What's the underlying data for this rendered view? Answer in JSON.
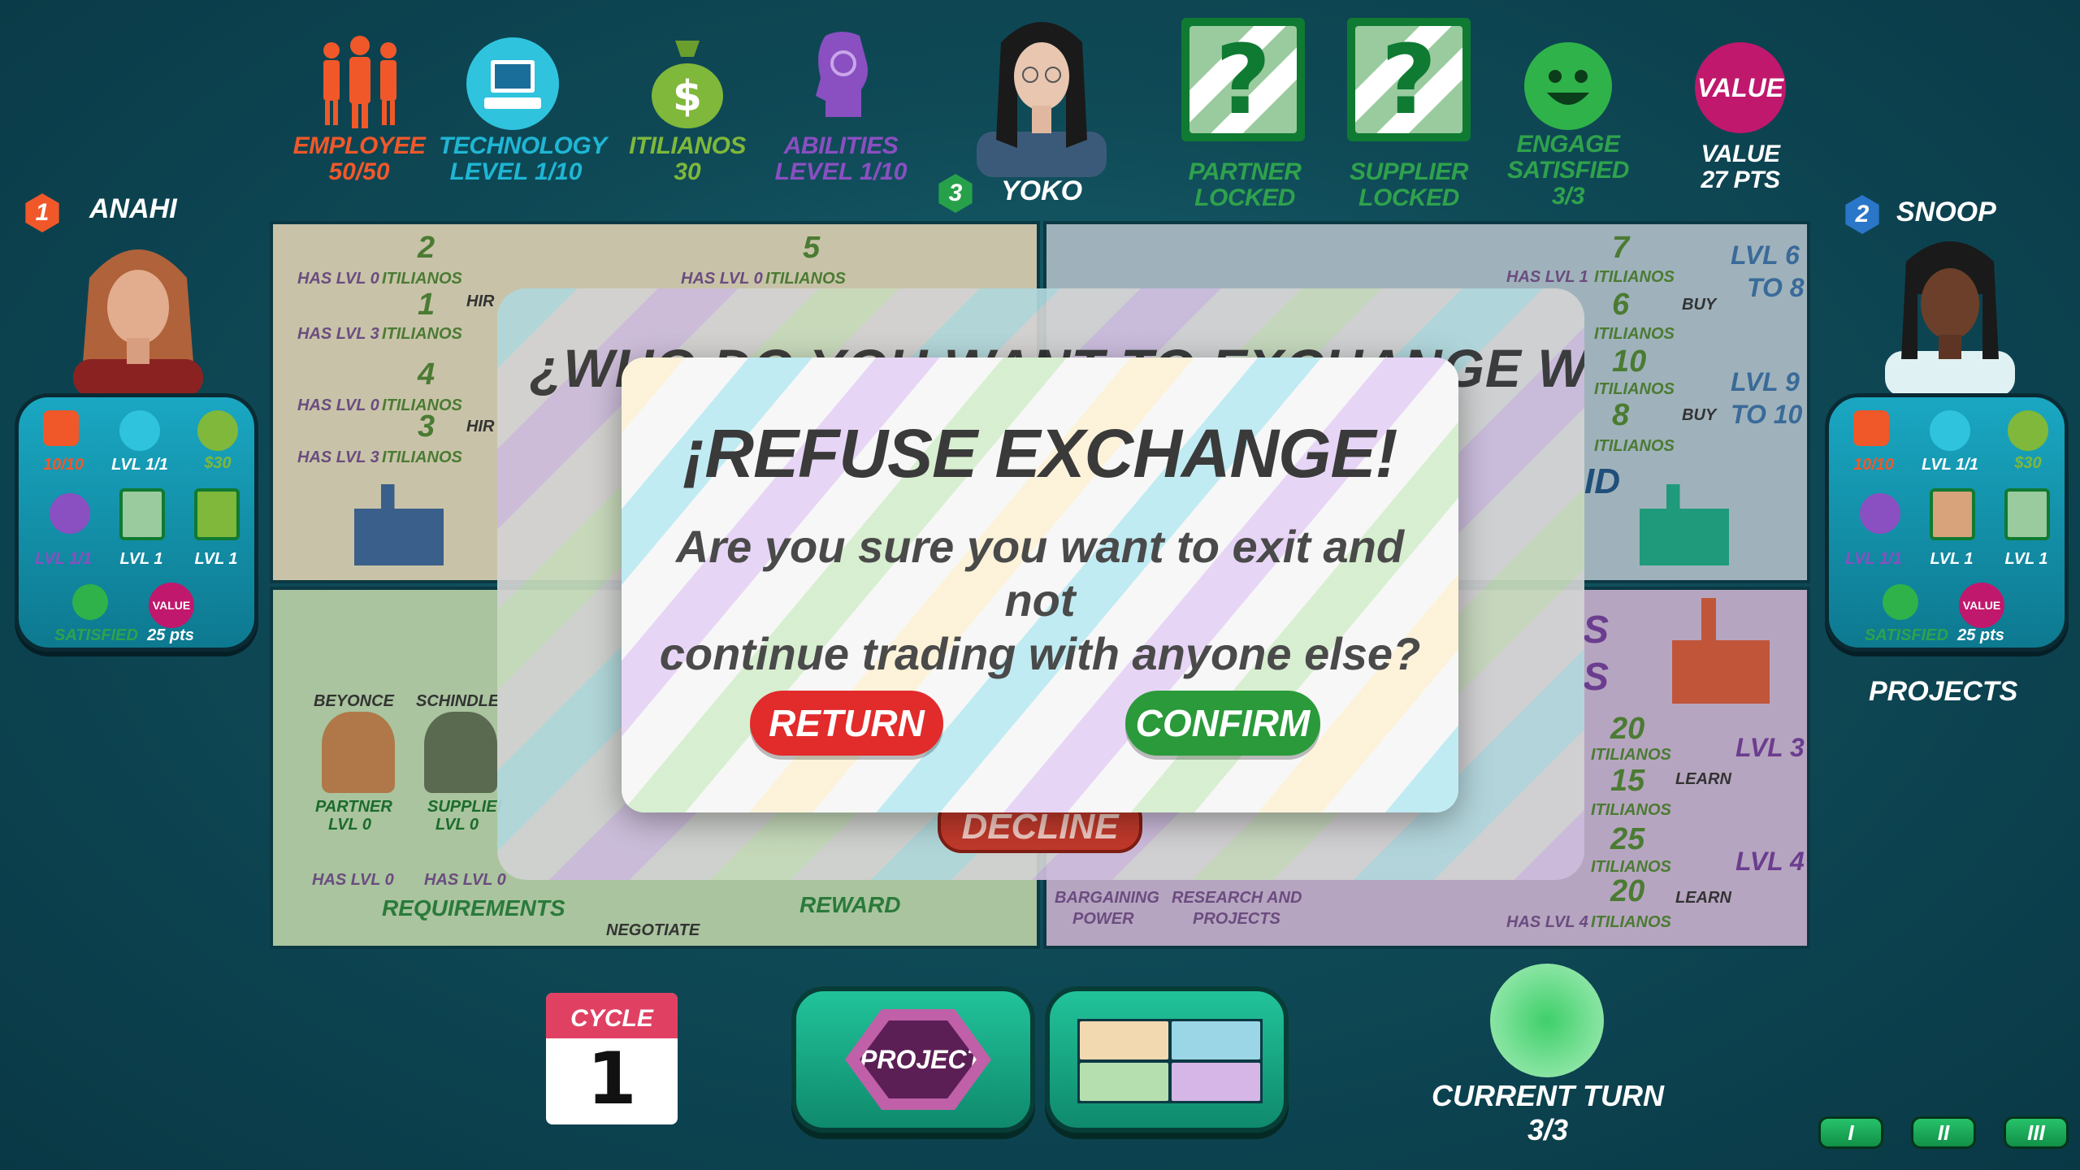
{
  "top": {
    "employee": {
      "label": "EMPLOYEE",
      "value": "50/50",
      "color": "#f0582a"
    },
    "technology": {
      "label": "TECHNOLOGY",
      "value": "LEVEL 1/10",
      "color": "#1fb6d4"
    },
    "itilianos": {
      "label": "ITILIANOS",
      "value": "30",
      "color": "#7fb83a"
    },
    "abilities": {
      "label": "ABILITIES",
      "value": "LEVEL 1/10",
      "color": "#8a4fc1"
    },
    "player": {
      "number": "3",
      "name": "YOKO"
    },
    "partner": {
      "line1": "PARTNER",
      "line2": "LOCKED"
    },
    "supplier": {
      "line1": "SUPPLIER",
      "line2": "LOCKED"
    },
    "engage": {
      "line1": "ENGAGE",
      "line2": "SATISFIED",
      "line3": "3/3"
    },
    "value": {
      "badge": "VALUE",
      "line1": "VALUE",
      "line2": "27 PTS"
    }
  },
  "left_player": {
    "number": "1",
    "name": "ANAHI",
    "employees": "10/10",
    "tech": "LVL 1/1",
    "money": "$30",
    "ability": "LVL 1/1",
    "partner": "LVL 1",
    "supplier": "LVL 1",
    "satisfied": "SATISFIED",
    "value_badge": "VALUE",
    "points": "25 pts"
  },
  "right_player": {
    "number": "2",
    "name": "SNOOP",
    "employees": "10/10",
    "tech": "LVL 1/1",
    "money": "$30",
    "ability": "LVL 1/1",
    "partner": "LVL 1",
    "supplier": "LVL 1",
    "satisfied": "SATISFIED",
    "value_badge": "VALUE",
    "points": "25 pts",
    "projects": "PROJECTS"
  },
  "board": {
    "tl": {
      "r1_req": "HAS LVL 0",
      "r1_cost": "2",
      "r1_unit": "ITILIANOS",
      "r1_action": "HIR",
      "r2_req": "HAS LVL 3",
      "r2_cost": "1",
      "r2_unit": "ITILIANOS",
      "r3_req": "HAS LVL 0",
      "r3_cost": "4",
      "r3_unit": "ITILIANOS",
      "r3_action": "HIR",
      "r4_req": "HAS LVL 3",
      "r4_cost": "3",
      "r4_unit": "ITILIANOS",
      "r5_req": "HAS LVL 0",
      "r5_cost": "5",
      "r5_unit": "ITILIANOS"
    },
    "tr": {
      "c1": "7",
      "c1_req": "HAS LVL 1",
      "c1_unit": "ITILIANOS",
      "c2": "6",
      "c2_unit": "ITILIANOS",
      "buy1": "BUY",
      "lvl_a1": "LVL 6",
      "lvl_a2": "TO 8",
      "c3": "10",
      "c3_unit": "ITILIANOS",
      "c4": "8",
      "c4_unit": "ITILIANOS",
      "buy2": "BUY",
      "lvl_b1": "LVL 9",
      "lvl_b2": "TO 10",
      "fragment": "ID"
    },
    "bl": {
      "beyonce": "BEYONCE",
      "schindler": "SCHINDLE",
      "partner": "PARTNER",
      "partner_lvl": "LVL 0",
      "supplier": "SUPPLIEI",
      "supplier_lvl": "LVL 0",
      "has1": "HAS LVL 0",
      "has2": "HAS LVL 0",
      "requirements": "REQUIREMENTS",
      "negotiate": "NEGOTIATE",
      "reward": "REWARD"
    },
    "br": {
      "s1": "S",
      "s2": "S",
      "c1": "20",
      "c1_unit": "ITILIANOS",
      "lvl3": "LVL 3",
      "learn1": "LEARN",
      "c2": "15",
      "c2_unit": "ITILIANOS",
      "c3": "25",
      "c3_unit": "ITILIANOS",
      "lvl4": "LVL 4",
      "c4": "20",
      "c4_unit": "ITILIANOS",
      "learn2": "LEARN",
      "has": "HAS LVL 4",
      "bargaining1": "BARGAINING",
      "bargaining2": "POWER",
      "research1": "RESEARCH AND",
      "research2": "PROJECTS"
    }
  },
  "back_dialog": {
    "title": "¿WHO DO YOU WANT TO EXCHANGE WITH?",
    "decline": "DECLINE"
  },
  "modal": {
    "title": "¡REFUSE EXCHANGE!",
    "line1": "Are you sure you want to exit and not",
    "line2": "continue trading with anyone else?",
    "return": "RETURN",
    "confirm": "CONFIRM"
  },
  "bottom": {
    "cycle_label": "CYCLE",
    "cycle_num": "1",
    "project": "PROJECT",
    "turn_line1": "CURRENT TURN",
    "turn_line2": "3/3",
    "tabs": [
      "I",
      "II",
      "III"
    ]
  }
}
